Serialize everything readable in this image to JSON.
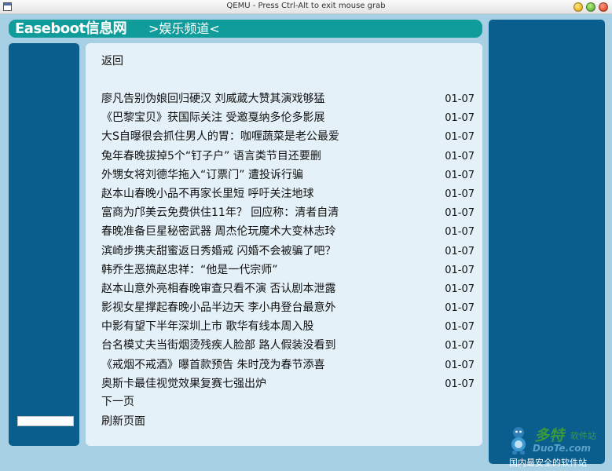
{
  "window": {
    "title": "QEMU - Press Ctrl-Alt to exit mouse grab"
  },
  "header": {
    "site_name": "Easeboot信息网",
    "channel": ">娱乐频道<"
  },
  "colors": {
    "header_bar": "#119c9c",
    "side_columns": "#0a5e8e",
    "background": "#a7d0e4",
    "content_panel": "#e4f1f8"
  },
  "main": {
    "back_label": "返回",
    "news": [
      {
        "title": "廖凡告别伪娘回归硬汉 刘威葳大赞其演戏够猛",
        "date": "01-07"
      },
      {
        "title": "《巴黎宝贝》获国际关注 受邀戛纳多伦多影展",
        "date": "01-07"
      },
      {
        "title": "大S自曝很会抓住男人的胃：咖喱蔬菜是老公最爱",
        "date": "01-07"
      },
      {
        "title": "兔年春晚拔掉5个“钉子户” 语言类节目还要删",
        "date": "01-07"
      },
      {
        "title": "外甥女将刘德华拖入“订票门” 遭投诉行骗",
        "date": "01-07"
      },
      {
        "title": "赵本山春晚小品不再家长里短 呼吁关注地球",
        "date": "01-07"
      },
      {
        "title": "富商为邝美云免费供住11年？ 回应称：清者自清",
        "date": "01-07"
      },
      {
        "title": "春晚准备巨星秘密武器 周杰伦玩魔术大变林志玲",
        "date": "01-07"
      },
      {
        "title": "滨崎步携夫甜蜜返日秀婚戒 闪婚不会被骗了吧？",
        "date": "01-07"
      },
      {
        "title": "韩乔生恶搞赵忠祥：“他是一代宗师”",
        "date": "01-07"
      },
      {
        "title": "赵本山意外亮相春晚审查只看不演 否认剧本泄露",
        "date": "01-07"
      },
      {
        "title": "影视女星撑起春晚小品半边天 李小冉登台最意外",
        "date": "01-07"
      },
      {
        "title": "中影有望下半年深圳上市 歌华有线本周入股",
        "date": "01-07"
      },
      {
        "title": "台名模丈夫当街烟烫残疾人脸部 路人假装没看到",
        "date": "01-07"
      },
      {
        "title": "《戒烟不戒酒》曝首款预告 朱时茂为春节添喜",
        "date": "01-07"
      },
      {
        "title": "奥斯卡最佳视觉效果复赛七强出炉",
        "date": "01-07"
      }
    ],
    "next_page_label": "下一页",
    "refresh_label": "刷新页面"
  },
  "watermark": {
    "title": "多特",
    "subtitle": "软件站",
    "url": "DuoTe.com",
    "tagline": "国内最安全的软件站"
  }
}
